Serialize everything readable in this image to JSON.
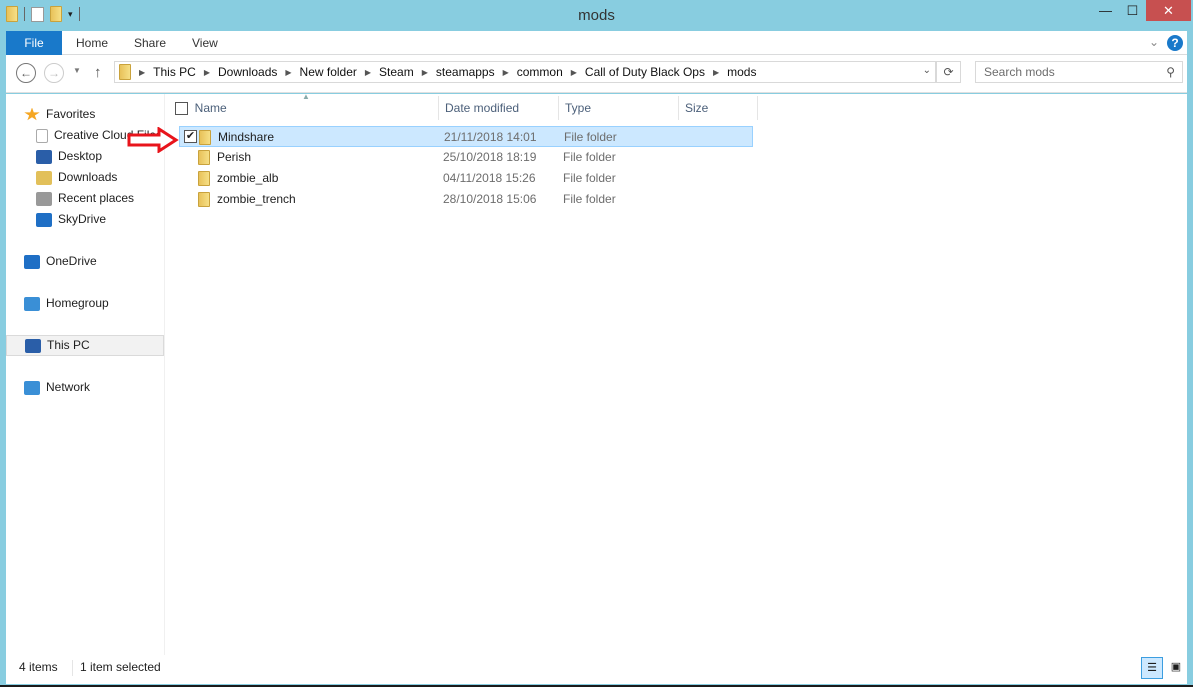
{
  "window": {
    "title": "mods",
    "minimize": "—",
    "maximize": "☐",
    "close": "✕"
  },
  "ribbon": {
    "tabs": [
      "File",
      "Home",
      "Share",
      "View"
    ],
    "help": "?"
  },
  "nav": {
    "back": "←",
    "forward": "→",
    "up": "↑",
    "breadcrumb": [
      "This PC",
      "Downloads",
      "New folder",
      "Steam",
      "steamapps",
      "common",
      "Call of Duty Black Ops",
      "mods"
    ],
    "search_placeholder": "Search mods"
  },
  "sidebar": {
    "items": [
      {
        "label": "Favorites",
        "icon": "star-icon"
      },
      {
        "label": "Creative Cloud Files",
        "icon": "document-icon"
      },
      {
        "label": "Desktop",
        "icon": "desktop-icon"
      },
      {
        "label": "Downloads",
        "icon": "downloads-icon"
      },
      {
        "label": "Recent places",
        "icon": "recent-icon"
      },
      {
        "label": "SkyDrive",
        "icon": "cloud-icon"
      },
      {
        "label": "OneDrive",
        "icon": "cloud-icon"
      },
      {
        "label": "Homegroup",
        "icon": "homegroup-icon"
      },
      {
        "label": "This PC",
        "icon": "pc-icon"
      },
      {
        "label": "Network",
        "icon": "network-icon"
      }
    ]
  },
  "columns": [
    "Name",
    "Date modified",
    "Type",
    "Size"
  ],
  "files": [
    {
      "name": "Mindshare",
      "date": "21/11/2018 14:01",
      "type": "File folder",
      "selected": true
    },
    {
      "name": "Perish",
      "date": "25/10/2018 18:19",
      "type": "File folder"
    },
    {
      "name": "zombie_alb",
      "date": "04/11/2018 15:26",
      "type": "File folder"
    },
    {
      "name": "zombie_trench",
      "date": "28/10/2018 15:06",
      "type": "File folder"
    }
  ],
  "status": {
    "count": "4 items",
    "selection": "1 item selected"
  },
  "colors": {
    "accent": "#1979ca",
    "frame": "#88cde0",
    "selection": "#cce8ff",
    "annotation": "#e8141b"
  }
}
